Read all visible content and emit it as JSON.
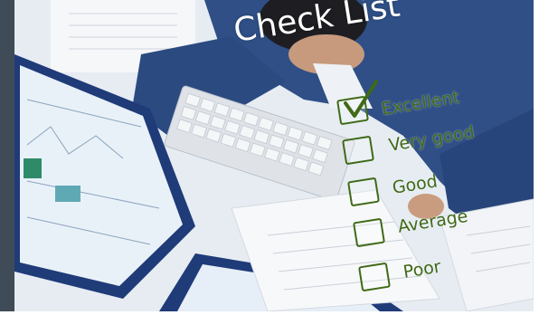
{
  "title": "Check List",
  "options": [
    {
      "label": "Excellent",
      "checked": true
    },
    {
      "label": "Very good",
      "checked": false
    },
    {
      "label": "Good",
      "checked": false
    },
    {
      "label": "Average",
      "checked": false
    },
    {
      "label": "Poor",
      "checked": false
    }
  ],
  "colors": {
    "option_text": "#3f6a18",
    "title_text": "#ffffff",
    "shirt": "#2f4f86",
    "monitor_frame": "#1f3b78"
  }
}
